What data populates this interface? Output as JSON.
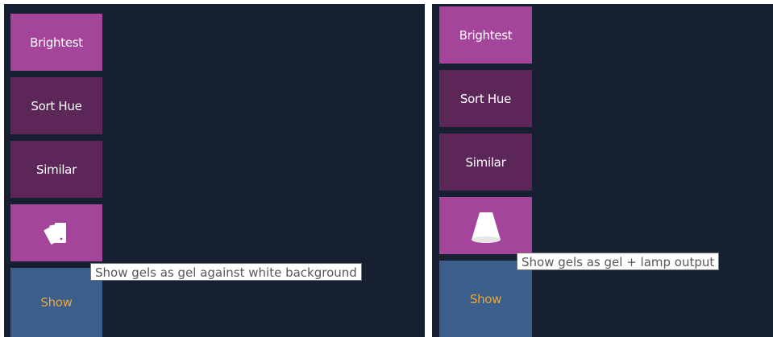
{
  "left_panel": {
    "buttons": {
      "brightest": "Brightest",
      "sort_hue": "Sort Hue",
      "similar": "Similar",
      "show": "Show"
    },
    "gel_mode_icon": "gel-cards-icon",
    "tooltip": "Show gels as gel against white background"
  },
  "right_panel": {
    "buttons": {
      "brightest": "Brightest",
      "sort_hue": "Sort Hue",
      "similar": "Similar",
      "show": "Show"
    },
    "gel_mode_icon": "lamp-cone-icon",
    "tooltip": "Show gels as gel + lamp output"
  },
  "colors": {
    "background": "#162030",
    "button_active": "#a5449b",
    "button_inactive": "#5c2658",
    "show_button": "#3b5f8a",
    "show_text": "#e8a83c"
  }
}
